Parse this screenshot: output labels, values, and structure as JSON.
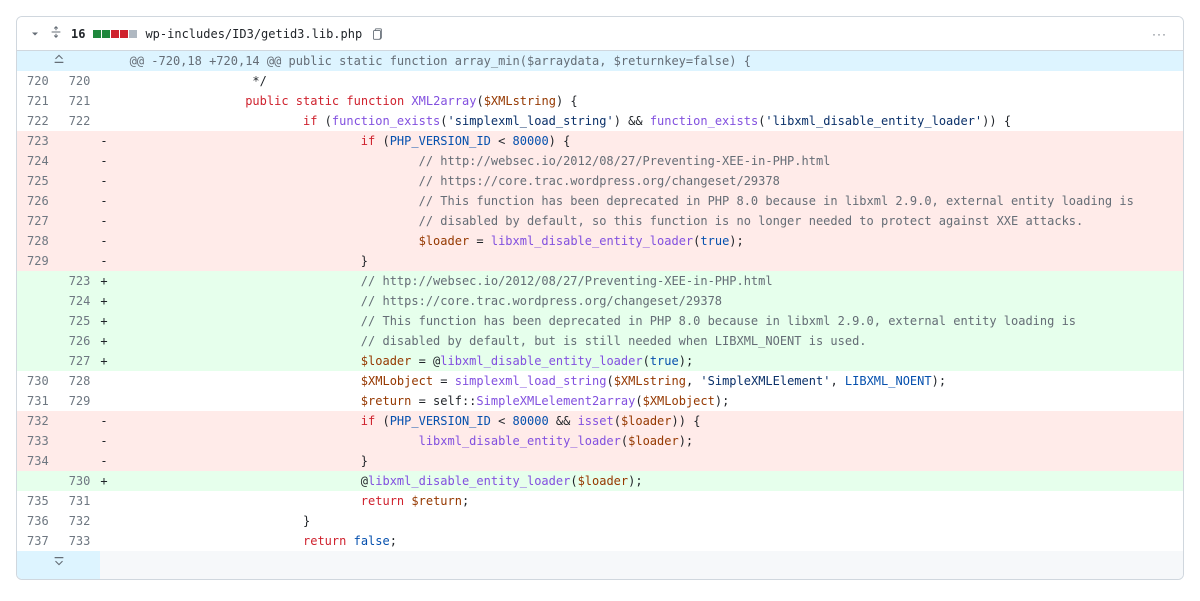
{
  "header": {
    "changeCount": "16",
    "filePath": "wp-includes/ID3/getid3.lib.php",
    "moreLabel": "···"
  },
  "hunk": {
    "text": "@@ -720,18 +720,14 @@ public static function array_min($arraydata, $returnkey=false) {"
  },
  "rows": [
    {
      "old": "720",
      "new": "720",
      "marker": " ",
      "seg": [
        {
          "c": "",
          "t": "\t\t */"
        }
      ]
    },
    {
      "old": "721",
      "new": "721",
      "marker": " ",
      "seg": [
        {
          "c": "",
          "t": "\t\t"
        },
        {
          "c": "pl-k",
          "t": "public"
        },
        {
          "c": "",
          "t": " "
        },
        {
          "c": "pl-k",
          "t": "static"
        },
        {
          "c": "",
          "t": " "
        },
        {
          "c": "pl-k",
          "t": "function"
        },
        {
          "c": "",
          "t": " "
        },
        {
          "c": "pl-en",
          "t": "XML2array"
        },
        {
          "c": "",
          "t": "("
        },
        {
          "c": "pl-v",
          "t": "$XMLstring"
        },
        {
          "c": "",
          "t": ") {"
        }
      ]
    },
    {
      "old": "722",
      "new": "722",
      "marker": " ",
      "seg": [
        {
          "c": "",
          "t": "\t\t\t"
        },
        {
          "c": "pl-k",
          "t": "if"
        },
        {
          "c": "",
          "t": " ("
        },
        {
          "c": "pl-en",
          "t": "function_exists"
        },
        {
          "c": "",
          "t": "("
        },
        {
          "c": "pl-s",
          "t": "'simplexml_load_string'"
        },
        {
          "c": "",
          "t": ") && "
        },
        {
          "c": "pl-en",
          "t": "function_exists"
        },
        {
          "c": "",
          "t": "("
        },
        {
          "c": "pl-s",
          "t": "'libxml_disable_entity_loader'"
        },
        {
          "c": "",
          "t": ")) {"
        }
      ]
    },
    {
      "old": "723",
      "new": "",
      "marker": "-",
      "seg": [
        {
          "c": "",
          "t": "\t\t\t\t"
        },
        {
          "c": "pl-k",
          "t": "if"
        },
        {
          "c": "",
          "t": " ("
        },
        {
          "c": "pl-c1",
          "t": "PHP_VERSION_ID"
        },
        {
          "c": "",
          "t": " < "
        },
        {
          "c": "pl-c1",
          "t": "80000"
        },
        {
          "c": "",
          "t": ") {"
        }
      ]
    },
    {
      "old": "724",
      "new": "",
      "marker": "-",
      "seg": [
        {
          "c": "",
          "t": "\t\t\t\t\t"
        },
        {
          "c": "pl-c",
          "t": "// http://websec.io/2012/08/27/Preventing-XEE-in-PHP.html"
        }
      ]
    },
    {
      "old": "725",
      "new": "",
      "marker": "-",
      "seg": [
        {
          "c": "",
          "t": "\t\t\t\t\t"
        },
        {
          "c": "pl-c",
          "t": "// https://core.trac.wordpress.org/changeset/29378"
        }
      ]
    },
    {
      "old": "726",
      "new": "",
      "marker": "-",
      "seg": [
        {
          "c": "",
          "t": "\t\t\t\t\t"
        },
        {
          "c": "pl-c",
          "t": "// This function has been deprecated in PHP 8.0 because in libxml 2.9.0, external entity loading is"
        }
      ]
    },
    {
      "old": "727",
      "new": "",
      "marker": "-",
      "seg": [
        {
          "c": "",
          "t": "\t\t\t\t\t"
        },
        {
          "c": "pl-c",
          "t": "// disabled by default, so this function is no longer needed to protect against XXE attacks."
        }
      ]
    },
    {
      "old": "728",
      "new": "",
      "marker": "-",
      "seg": [
        {
          "c": "",
          "t": "\t\t\t\t\t"
        },
        {
          "c": "pl-v",
          "t": "$loader"
        },
        {
          "c": "",
          "t": " = "
        },
        {
          "c": "pl-en",
          "t": "libxml_disable_entity_loader"
        },
        {
          "c": "",
          "t": "("
        },
        {
          "c": "pl-c1",
          "t": "true"
        },
        {
          "c": "",
          "t": ");"
        }
      ]
    },
    {
      "old": "729",
      "new": "",
      "marker": "-",
      "seg": [
        {
          "c": "",
          "t": "\t\t\t\t}"
        }
      ]
    },
    {
      "old": "",
      "new": "723",
      "marker": "+",
      "seg": [
        {
          "c": "",
          "t": "\t\t\t\t"
        },
        {
          "c": "pl-c",
          "t": "// http://websec.io/2012/08/27/Preventing-XEE-in-PHP.html"
        }
      ]
    },
    {
      "old": "",
      "new": "724",
      "marker": "+",
      "seg": [
        {
          "c": "",
          "t": "\t\t\t\t"
        },
        {
          "c": "pl-c",
          "t": "// https://core.trac.wordpress.org/changeset/29378"
        }
      ]
    },
    {
      "old": "",
      "new": "725",
      "marker": "+",
      "seg": [
        {
          "c": "",
          "t": "\t\t\t\t"
        },
        {
          "c": "pl-c",
          "t": "// This function has been deprecated in PHP 8.0 because in libxml 2.9.0, external entity loading is"
        }
      ]
    },
    {
      "old": "",
      "new": "726",
      "marker": "+",
      "seg": [
        {
          "c": "",
          "t": "\t\t\t\t"
        },
        {
          "c": "pl-c",
          "t": "// disabled by default, but is still needed when LIBXML_NOENT is used."
        }
      ]
    },
    {
      "old": "",
      "new": "727",
      "marker": "+",
      "seg": [
        {
          "c": "",
          "t": "\t\t\t\t"
        },
        {
          "c": "pl-v",
          "t": "$loader"
        },
        {
          "c": "",
          "t": " = @"
        },
        {
          "c": "pl-en",
          "t": "libxml_disable_entity_loader"
        },
        {
          "c": "",
          "t": "("
        },
        {
          "c": "pl-c1",
          "t": "true"
        },
        {
          "c": "",
          "t": ");"
        }
      ]
    },
    {
      "old": "730",
      "new": "728",
      "marker": " ",
      "seg": [
        {
          "c": "",
          "t": "\t\t\t\t"
        },
        {
          "c": "pl-v",
          "t": "$XMLobject"
        },
        {
          "c": "",
          "t": " = "
        },
        {
          "c": "pl-en",
          "t": "simplexml_load_string"
        },
        {
          "c": "",
          "t": "("
        },
        {
          "c": "pl-v",
          "t": "$XMLstring"
        },
        {
          "c": "",
          "t": ", "
        },
        {
          "c": "pl-s",
          "t": "'SimpleXMLElement'"
        },
        {
          "c": "",
          "t": ", "
        },
        {
          "c": "pl-c1",
          "t": "LIBXML_NOENT"
        },
        {
          "c": "",
          "t": ");"
        }
      ]
    },
    {
      "old": "731",
      "new": "729",
      "marker": " ",
      "seg": [
        {
          "c": "",
          "t": "\t\t\t\t"
        },
        {
          "c": "pl-v",
          "t": "$return"
        },
        {
          "c": "",
          "t": " = self::"
        },
        {
          "c": "pl-en",
          "t": "SimpleXMLelement2array"
        },
        {
          "c": "",
          "t": "("
        },
        {
          "c": "pl-v",
          "t": "$XMLobject"
        },
        {
          "c": "",
          "t": ");"
        }
      ]
    },
    {
      "old": "732",
      "new": "",
      "marker": "-",
      "seg": [
        {
          "c": "",
          "t": "\t\t\t\t"
        },
        {
          "c": "pl-k",
          "t": "if"
        },
        {
          "c": "",
          "t": " ("
        },
        {
          "c": "pl-c1",
          "t": "PHP_VERSION_ID"
        },
        {
          "c": "",
          "t": " < "
        },
        {
          "c": "pl-c1",
          "t": "80000"
        },
        {
          "c": "",
          "t": " && "
        },
        {
          "c": "pl-en",
          "t": "isset"
        },
        {
          "c": "",
          "t": "("
        },
        {
          "c": "pl-v",
          "t": "$loader"
        },
        {
          "c": "",
          "t": ")) {"
        }
      ]
    },
    {
      "old": "733",
      "new": "",
      "marker": "-",
      "seg": [
        {
          "c": "",
          "t": "\t\t\t\t\t"
        },
        {
          "c": "pl-en",
          "t": "libxml_disable_entity_loader"
        },
        {
          "c": "",
          "t": "("
        },
        {
          "c": "pl-v",
          "t": "$loader"
        },
        {
          "c": "",
          "t": ");"
        }
      ]
    },
    {
      "old": "734",
      "new": "",
      "marker": "-",
      "seg": [
        {
          "c": "",
          "t": "\t\t\t\t}"
        }
      ]
    },
    {
      "old": "",
      "new": "730",
      "marker": "+",
      "seg": [
        {
          "c": "",
          "t": "\t\t\t\t@"
        },
        {
          "c": "pl-en",
          "t": "libxml_disable_entity_loader"
        },
        {
          "c": "",
          "t": "("
        },
        {
          "c": "pl-v",
          "t": "$loader"
        },
        {
          "c": "",
          "t": ");"
        }
      ]
    },
    {
      "old": "735",
      "new": "731",
      "marker": " ",
      "seg": [
        {
          "c": "",
          "t": "\t\t\t\t"
        },
        {
          "c": "pl-k",
          "t": "return"
        },
        {
          "c": "",
          "t": " "
        },
        {
          "c": "pl-v",
          "t": "$return"
        },
        {
          "c": "",
          "t": ";"
        }
      ]
    },
    {
      "old": "736",
      "new": "732",
      "marker": " ",
      "seg": [
        {
          "c": "",
          "t": "\t\t\t}"
        }
      ]
    },
    {
      "old": "737",
      "new": "733",
      "marker": " ",
      "seg": [
        {
          "c": "",
          "t": "\t\t\t"
        },
        {
          "c": "pl-k",
          "t": "return"
        },
        {
          "c": "",
          "t": " "
        },
        {
          "c": "pl-c1",
          "t": "false"
        },
        {
          "c": "",
          "t": ";"
        }
      ]
    }
  ]
}
